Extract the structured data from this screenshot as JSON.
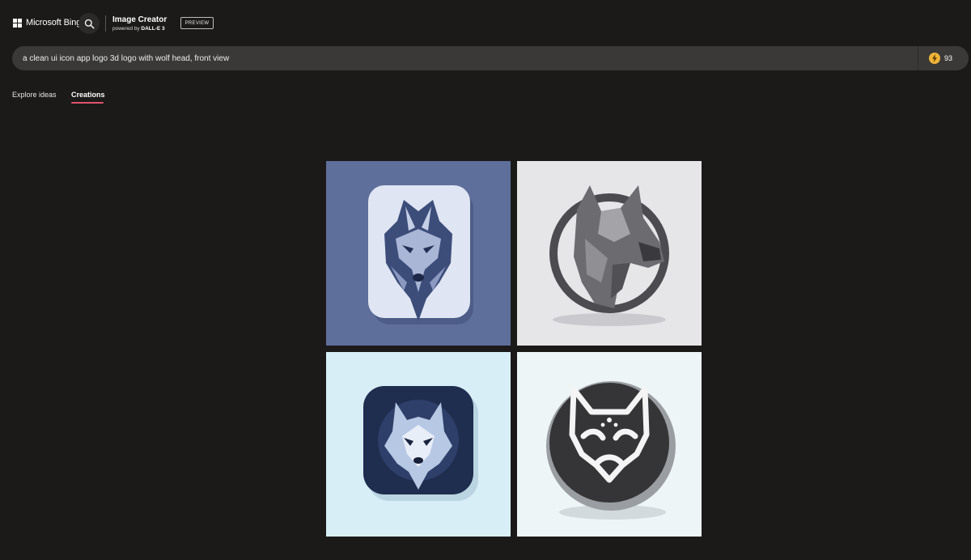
{
  "header": {
    "brand_label": "Microsoft Bing",
    "app_title": "Image Creator",
    "powered_by_prefix": "powered by",
    "powered_by_model": "DALL-E 3",
    "preview_badge": "PREVIEW"
  },
  "prompt": {
    "value": "a clean ui icon app logo 3d logo with wolf head, front view",
    "boosts": "93"
  },
  "tabs": [
    {
      "label": "Explore ideas",
      "active": false
    },
    {
      "label": "Creations",
      "active": true
    }
  ],
  "icons": [
    "microsoft-logo-icon",
    "search-icon",
    "lightning-bolt-icon"
  ],
  "colors": {
    "background": "#1b1a19",
    "prompt_bar": "#3a3938",
    "active_tab_underline": "#e0536c",
    "boost_coin": "#f0b43a"
  }
}
